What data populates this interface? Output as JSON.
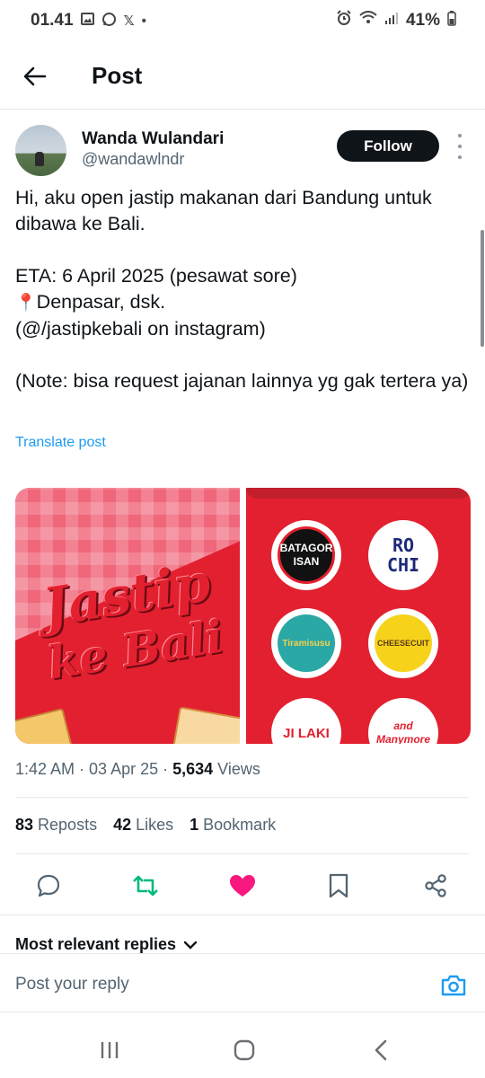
{
  "status_bar": {
    "time": "01.41",
    "notification_icons": [
      "image-icon",
      "whatsapp-icon",
      "x-icon",
      "dot-icon"
    ],
    "x_glyph": "𝕏",
    "dot_glyph": "•",
    "battery": "41%",
    "system_icons": [
      "alarm-icon",
      "wifi-icon",
      "signal-icon",
      "battery-icon"
    ]
  },
  "header": {
    "title": "Post",
    "back_icon": "arrow-left-icon"
  },
  "post": {
    "author_name": "Wanda Wulandari",
    "author_handle": "@wandawlndr",
    "follow_label": "Follow",
    "text_line1": "Hi, aku open jastip makanan dari Bandung untuk dibawa ke Bali.",
    "text_line2": "ETA: 6 April 2025 (pesawat sore)",
    "pin_emoji": "📍",
    "text_line3": "Denpasar, dsk.",
    "text_line4": "(@/jastipkebali on instagram)",
    "text_line5": "(Note: bisa request jajanan lainnya yg gak tertera ya)",
    "translate_label": "Translate post",
    "media": {
      "left_title_line1": "Jastip",
      "left_title_line2": "ke Bali",
      "logos": {
        "batagor": "BATAGOR ISAN",
        "rochi": "RO CHI",
        "tiramisusu": "Tiramisusu",
        "cheesecuit": "CHEESECUIT",
        "jilaki": "JI LAKI",
        "many": "and Manymore"
      }
    },
    "timestamp": "1:42 AM · 03 Apr 25 · ",
    "views_count": "5,634",
    "views_label": " Views",
    "reposts_count": "83",
    "reposts_label": "Reposts",
    "likes_count": "42",
    "likes_label": "Likes",
    "bookmarks_count": "1",
    "bookmarks_label": "Bookmark"
  },
  "actions": [
    "reply-icon",
    "repost-icon",
    "like-icon",
    "bookmark-icon",
    "share-icon"
  ],
  "colors": {
    "accent_blue": "#1d9bf0",
    "repost_green": "#00ba7c",
    "like_pink": "#f91880",
    "text_primary": "#0f1419",
    "text_secondary": "#536471"
  },
  "replies": {
    "sort_label": "Most relevant replies",
    "reply_placeholder": "Post your reply"
  },
  "nav": [
    "recents-icon",
    "home-icon",
    "back-icon"
  ]
}
